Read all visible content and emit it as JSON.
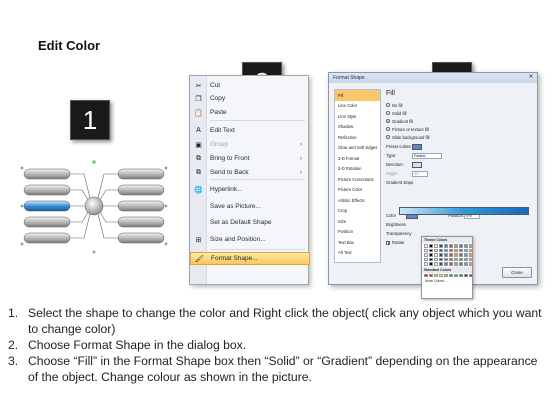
{
  "title": "Edit Color",
  "badges": [
    "1",
    "2",
    "3"
  ],
  "context_menu": {
    "items": [
      {
        "label": "Cut",
        "icon": "scissors-icon",
        "glyph": "✂",
        "disabled": false,
        "submenu": false
      },
      {
        "label": "Copy",
        "icon": "copy-icon",
        "glyph": "❐",
        "disabled": false,
        "submenu": false
      },
      {
        "label": "Paste",
        "icon": "paste-icon",
        "glyph": "📋",
        "disabled": false,
        "submenu": false
      },
      {
        "label": "Edit Text",
        "icon": "edit-text-icon",
        "glyph": "A",
        "disabled": false,
        "submenu": false
      },
      {
        "label": "Group",
        "icon": "group-icon",
        "glyph": "▣",
        "disabled": true,
        "submenu": true
      },
      {
        "label": "Bring to Front",
        "icon": "bring-front-icon",
        "glyph": "⧉",
        "disabled": false,
        "submenu": true
      },
      {
        "label": "Send to Back",
        "icon": "send-back-icon",
        "glyph": "⧉",
        "disabled": false,
        "submenu": true
      },
      {
        "label": "Hyperlink...",
        "icon": "hyperlink-icon",
        "glyph": "🌐",
        "disabled": false,
        "submenu": false
      },
      {
        "label": "Save as Picture...",
        "icon": "",
        "glyph": "",
        "disabled": false,
        "submenu": false
      },
      {
        "label": "Set as Default Shape",
        "icon": "",
        "glyph": "",
        "disabled": false,
        "submenu": false
      },
      {
        "label": "Size and Position...",
        "icon": "size-position-icon",
        "glyph": "⊞",
        "disabled": false,
        "submenu": false
      },
      {
        "label": "Format Shape...",
        "icon": "format-shape-icon",
        "glyph": "🖌",
        "disabled": false,
        "submenu": false,
        "highlighted": true
      }
    ]
  },
  "dialog": {
    "title": "Format Shape",
    "close_glyph": "✕",
    "nav": [
      "Fill",
      "Line Color",
      "Line Style",
      "Shadow",
      "Reflection",
      "Glow and Soft Edges",
      "3-D Format",
      "3-D Rotation",
      "Picture Corrections",
      "Picture Color",
      "Artistic Effects",
      "Crop",
      "Size",
      "Position",
      "Text Box",
      "Alt Text"
    ],
    "nav_selected": 0,
    "fill_heading": "Fill",
    "fill_options": [
      {
        "label": "No fill",
        "on": false
      },
      {
        "label": "Solid fill",
        "on": false
      },
      {
        "label": "Gradient fill",
        "on": true
      },
      {
        "label": "Picture or texture fill",
        "on": false
      },
      {
        "label": "Slide background fill",
        "on": false
      }
    ],
    "preset_label": "Preset colors:",
    "type_label": "Type:",
    "type_value": "Radial",
    "direction_label": "Direction:",
    "angle_label": "Angle:",
    "angle_value": "90°",
    "stops_label": "Gradient stops",
    "color_label": "Color",
    "position_label": "Position:",
    "position_value": "0%",
    "brightness_label": "Brightness",
    "transparency_label": "Transparency",
    "rotate_label": "Rotate",
    "close_button": "Close"
  },
  "palette": {
    "theme_heading": "Theme Colors",
    "standard_heading": "Standard Colors",
    "more_label": "More Colors...",
    "theme_colors": [
      "#ffffff",
      "#000000",
      "#eeece1",
      "#1f497d",
      "#4f81bd",
      "#c0504d",
      "#9bbb59",
      "#8064a2",
      "#4bacc6",
      "#f79646"
    ],
    "standard_colors": [
      "#c00000",
      "#ff0000",
      "#ffc000",
      "#ffff00",
      "#92d050",
      "#00b050",
      "#00b0f0",
      "#0070c0",
      "#002060",
      "#7030a0"
    ]
  },
  "steps": [
    {
      "n": "1.",
      "text": "Select the shape to change the color and Right click the object( click any object which you want to change color)"
    },
    {
      "n": "2.",
      "text": "Choose Format Shape in the dialog box."
    },
    {
      "n": "3.",
      "text": "Choose “Fill” in the Format Shape box then “Solid” or “Gradient” depending on the appearance of the object. Change colour as shown in the picture."
    }
  ],
  "colors": {
    "accent": "#3a8fd8",
    "highlight": "#f9c75b",
    "badge": "#1a1a1a"
  }
}
